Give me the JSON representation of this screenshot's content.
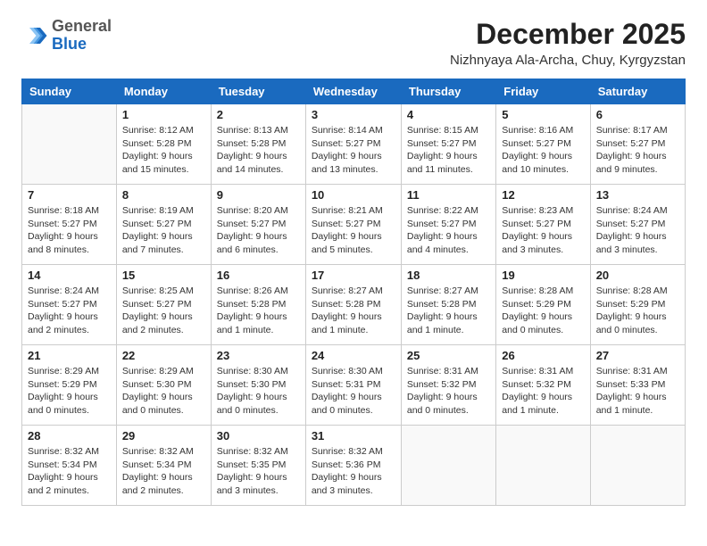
{
  "header": {
    "logo": {
      "general": "General",
      "blue": "Blue"
    },
    "month_title": "December 2025",
    "location": "Nizhnyaya Ala-Archa, Chuy, Kyrgyzstan"
  },
  "calendar": {
    "weekdays": [
      "Sunday",
      "Monday",
      "Tuesday",
      "Wednesday",
      "Thursday",
      "Friday",
      "Saturday"
    ],
    "weeks": [
      [
        {
          "day": "",
          "info": ""
        },
        {
          "day": "1",
          "info": "Sunrise: 8:12 AM\nSunset: 5:28 PM\nDaylight: 9 hours and 15 minutes."
        },
        {
          "day": "2",
          "info": "Sunrise: 8:13 AM\nSunset: 5:28 PM\nDaylight: 9 hours and 14 minutes."
        },
        {
          "day": "3",
          "info": "Sunrise: 8:14 AM\nSunset: 5:27 PM\nDaylight: 9 hours and 13 minutes."
        },
        {
          "day": "4",
          "info": "Sunrise: 8:15 AM\nSunset: 5:27 PM\nDaylight: 9 hours and 11 minutes."
        },
        {
          "day": "5",
          "info": "Sunrise: 8:16 AM\nSunset: 5:27 PM\nDaylight: 9 hours and 10 minutes."
        },
        {
          "day": "6",
          "info": "Sunrise: 8:17 AM\nSunset: 5:27 PM\nDaylight: 9 hours and 9 minutes."
        }
      ],
      [
        {
          "day": "7",
          "info": "Sunrise: 8:18 AM\nSunset: 5:27 PM\nDaylight: 9 hours and 8 minutes."
        },
        {
          "day": "8",
          "info": "Sunrise: 8:19 AM\nSunset: 5:27 PM\nDaylight: 9 hours and 7 minutes."
        },
        {
          "day": "9",
          "info": "Sunrise: 8:20 AM\nSunset: 5:27 PM\nDaylight: 9 hours and 6 minutes."
        },
        {
          "day": "10",
          "info": "Sunrise: 8:21 AM\nSunset: 5:27 PM\nDaylight: 9 hours and 5 minutes."
        },
        {
          "day": "11",
          "info": "Sunrise: 8:22 AM\nSunset: 5:27 PM\nDaylight: 9 hours and 4 minutes."
        },
        {
          "day": "12",
          "info": "Sunrise: 8:23 AM\nSunset: 5:27 PM\nDaylight: 9 hours and 3 minutes."
        },
        {
          "day": "13",
          "info": "Sunrise: 8:24 AM\nSunset: 5:27 PM\nDaylight: 9 hours and 3 minutes."
        }
      ],
      [
        {
          "day": "14",
          "info": "Sunrise: 8:24 AM\nSunset: 5:27 PM\nDaylight: 9 hours and 2 minutes."
        },
        {
          "day": "15",
          "info": "Sunrise: 8:25 AM\nSunset: 5:27 PM\nDaylight: 9 hours and 2 minutes."
        },
        {
          "day": "16",
          "info": "Sunrise: 8:26 AM\nSunset: 5:28 PM\nDaylight: 9 hours and 1 minute."
        },
        {
          "day": "17",
          "info": "Sunrise: 8:27 AM\nSunset: 5:28 PM\nDaylight: 9 hours and 1 minute."
        },
        {
          "day": "18",
          "info": "Sunrise: 8:27 AM\nSunset: 5:28 PM\nDaylight: 9 hours and 1 minute."
        },
        {
          "day": "19",
          "info": "Sunrise: 8:28 AM\nSunset: 5:29 PM\nDaylight: 9 hours and 0 minutes."
        },
        {
          "day": "20",
          "info": "Sunrise: 8:28 AM\nSunset: 5:29 PM\nDaylight: 9 hours and 0 minutes."
        }
      ],
      [
        {
          "day": "21",
          "info": "Sunrise: 8:29 AM\nSunset: 5:29 PM\nDaylight: 9 hours and 0 minutes."
        },
        {
          "day": "22",
          "info": "Sunrise: 8:29 AM\nSunset: 5:30 PM\nDaylight: 9 hours and 0 minutes."
        },
        {
          "day": "23",
          "info": "Sunrise: 8:30 AM\nSunset: 5:30 PM\nDaylight: 9 hours and 0 minutes."
        },
        {
          "day": "24",
          "info": "Sunrise: 8:30 AM\nSunset: 5:31 PM\nDaylight: 9 hours and 0 minutes."
        },
        {
          "day": "25",
          "info": "Sunrise: 8:31 AM\nSunset: 5:32 PM\nDaylight: 9 hours and 0 minutes."
        },
        {
          "day": "26",
          "info": "Sunrise: 8:31 AM\nSunset: 5:32 PM\nDaylight: 9 hours and 1 minute."
        },
        {
          "day": "27",
          "info": "Sunrise: 8:31 AM\nSunset: 5:33 PM\nDaylight: 9 hours and 1 minute."
        }
      ],
      [
        {
          "day": "28",
          "info": "Sunrise: 8:32 AM\nSunset: 5:34 PM\nDaylight: 9 hours and 2 minutes."
        },
        {
          "day": "29",
          "info": "Sunrise: 8:32 AM\nSunset: 5:34 PM\nDaylight: 9 hours and 2 minutes."
        },
        {
          "day": "30",
          "info": "Sunrise: 8:32 AM\nSunset: 5:35 PM\nDaylight: 9 hours and 3 minutes."
        },
        {
          "day": "31",
          "info": "Sunrise: 8:32 AM\nSunset: 5:36 PM\nDaylight: 9 hours and 3 minutes."
        },
        {
          "day": "",
          "info": ""
        },
        {
          "day": "",
          "info": ""
        },
        {
          "day": "",
          "info": ""
        }
      ]
    ]
  }
}
